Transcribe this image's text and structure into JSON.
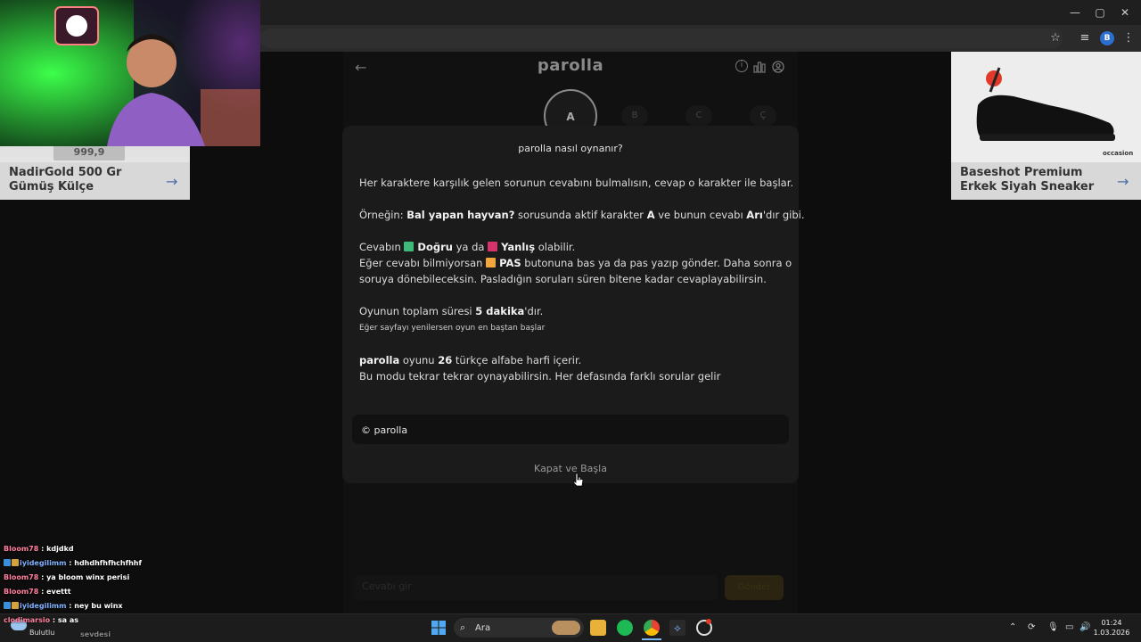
{
  "browser": {
    "window_controls": [
      "—",
      "▢",
      "✕"
    ],
    "toolbar_icons": [
      "star-icon",
      "media-icon",
      "menu-icon"
    ],
    "profile_initial": "B"
  },
  "game": {
    "logo": "parolla",
    "current_letter": "A",
    "next_letters": [
      "B",
      "C",
      "Ç"
    ]
  },
  "ads": {
    "left": {
      "title_line1": "NadirGold 500 Gr",
      "title_line2": "Gümüş Külçe",
      "price_tag": "999,9"
    },
    "right": {
      "title_line1": "Baseshot Premium",
      "title_line2": "Erkek Siyah Sneaker",
      "brand": "occasion"
    }
  },
  "modal": {
    "title": "parolla nasıl oynanır?",
    "p1": "Her karaktere karşılık gelen sorunun cevabını bulmalısın, cevap o karakter ile başlar.",
    "p2_a": "Örneğin: ",
    "p2_b": "Bal yapan hayvan?",
    "p2_c": " sorusunda aktif karakter ",
    "p2_d": "A",
    "p2_e": " ve bunun cevabı ",
    "p2_f": "Arı",
    "p2_g": "'dır gibi.",
    "p3_a": "Cevabın ",
    "p3_b": "Doğru",
    "p3_c": " ya da ",
    "p3_d": "Yanlış",
    "p3_e": " olabilir.",
    "p4_a": "Eğer cevabı bilmiyorsan ",
    "p4_b": "PAS",
    "p4_c": " butonuna bas ya da pas yazıp gönder. Daha sonra o",
    "p5": "soruya dönebileceksin. Pasladığın soruları süren bitene kadar cevaplayabilirsin.",
    "p6_a": "Oyunun toplam süresi ",
    "p6_b": "5 dakika",
    "p6_c": "'dır.",
    "p7": "Eğer sayfayı yenilersen oyun en baştan başlar",
    "p8_a": "parolla",
    "p8_b": " oyunu ",
    "p8_c": "26",
    "p8_d": " türkçe alfabe harfi içerir.",
    "p9": "Bu modu tekrar tekrar oynayabilirsin. Her defasında farklı sorular gelir",
    "footer": "© parolla",
    "close_button": "Kapat ve Başla",
    "colors": {
      "correct": "#3fb97a",
      "wrong": "#d6336c",
      "pass": "#f0a63a"
    }
  },
  "answer": {
    "placeholder": "Cevabı gir",
    "send": "Gönder"
  },
  "chat": [
    {
      "user": "Bloom78",
      "msg": " : kdjdkd",
      "badges": false
    },
    {
      "user": "iyidegilimm",
      "msg": " : hdhdhfhfhchfhhf",
      "badges": true
    },
    {
      "user": "Bloom78",
      "msg": " : ya bloom winx perisi",
      "badges": false
    },
    {
      "user": "Bloom78",
      "msg": " : evettt",
      "badges": false
    },
    {
      "user": "iyidegilimm",
      "msg": " : ney bu winx",
      "badges": true
    },
    {
      "user": "clodimarsio",
      "msg": " : sa as",
      "badges": false
    },
    {
      "user": "",
      "msg": "sevdesi",
      "badges": false
    }
  ],
  "taskbar": {
    "search_label": "Ara",
    "weather": "Bulutlu",
    "time": "01:24",
    "date": "1.03.2026"
  }
}
